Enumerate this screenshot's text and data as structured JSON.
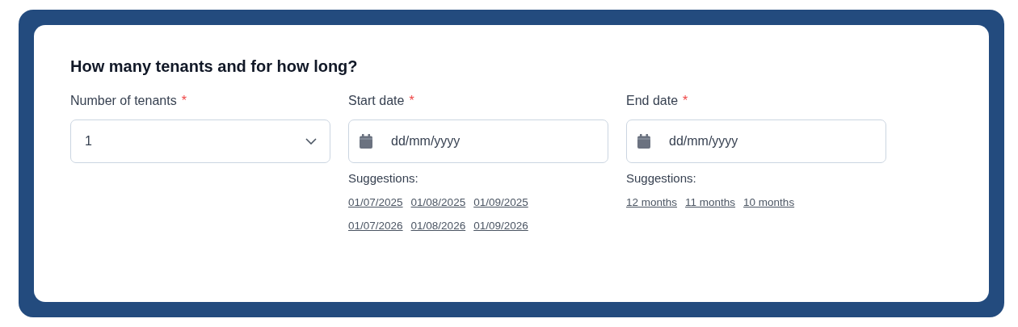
{
  "heading": "How many tenants and for how long?",
  "fields": [
    {
      "kind": "select",
      "label": "Number of tenants",
      "required_mark": "*",
      "value": "1"
    },
    {
      "kind": "date",
      "label": "Start date",
      "required_mark": "*",
      "placeholder": "dd/mm/yyyy",
      "suggestions_label": "Suggestions:",
      "suggestions": [
        "01/07/2025",
        "01/08/2025",
        "01/09/2025",
        "01/07/2026",
        "01/08/2026",
        "01/09/2026"
      ]
    },
    {
      "kind": "date",
      "label": "End date",
      "required_mark": "*",
      "placeholder": "dd/mm/yyyy",
      "suggestions_label": "Suggestions:",
      "suggestions": [
        "12 months",
        "11 months",
        "10 months"
      ]
    }
  ]
}
